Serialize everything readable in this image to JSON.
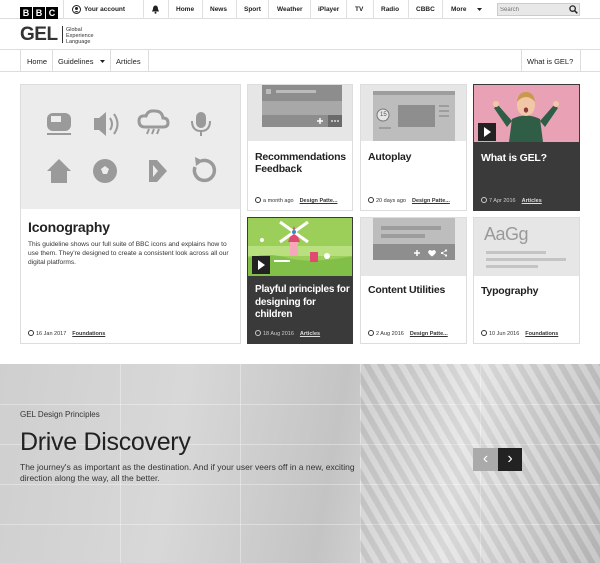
{
  "topbar": {
    "brand": [
      "B",
      "B",
      "C"
    ],
    "account": "Your account",
    "nav": [
      "Home",
      "News",
      "Sport",
      "Weather",
      "iPlayer",
      "TV",
      "Radio",
      "CBBC",
      "More"
    ],
    "search_placeholder": "Search"
  },
  "gel": {
    "logo": "GEL",
    "tagline": [
      "Global",
      "Experience",
      "Language"
    ]
  },
  "subnav": {
    "home": "Home",
    "guidelines": "Guidelines",
    "articles": "Articles",
    "what_is": "What is GEL?"
  },
  "cards": {
    "iconography": {
      "title": "Iconography",
      "desc": "This guideline shows our full suite of BBC icons and explains how to use them. They're designed to create a consistent look across all our digital platforms.",
      "date": "16 Jan 2017",
      "tag": "Foundations"
    },
    "recommendations": {
      "title": "Recommendations Feedback",
      "date": "a month ago",
      "tag": "Design Patte..."
    },
    "autoplay": {
      "title": "Autoplay",
      "date": "20 days ago",
      "tag": "Design Patte...",
      "badge": "15"
    },
    "whatisgel": {
      "title": "What is GEL?",
      "date": "7 Apr 2016",
      "tag": "Articles"
    },
    "playful": {
      "title": "Playful principles for designing for children",
      "date": "18 Aug 2016",
      "tag": "Articles"
    },
    "content": {
      "title": "Content Utilities",
      "date": "2 Aug 2016",
      "tag": "Design Patte..."
    },
    "typography": {
      "title": "Typography",
      "date": "10 Jun 2016",
      "tag": "Foundations",
      "sample": "AaGg"
    }
  },
  "hero": {
    "subtitle": "GEL Design Principles",
    "title": "Drive Discovery",
    "text": "The journey's as important as the destination. And if your user veers off in a new, exciting direction along the way, all the better.",
    "prev": "‹",
    "next": "›"
  },
  "colors": {
    "dark_card": "#3a3a3a",
    "accent_pink": "#e8a0b0",
    "accent_green": "#9dcf5a",
    "icon_grey": "#9a9a9a"
  }
}
